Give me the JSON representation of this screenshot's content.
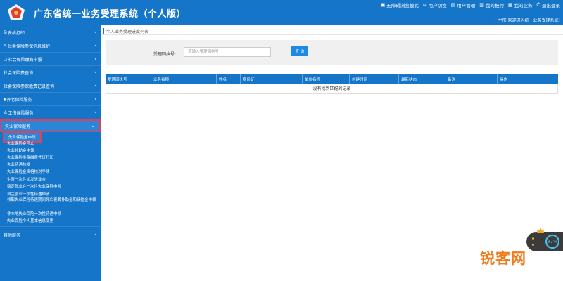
{
  "header": {
    "title": "广东省统一业务受理系统（个人版）",
    "links": [
      {
        "icon": "monitor-icon",
        "label": "无障碍浏览模式"
      },
      {
        "icon": "user-switch-icon",
        "label": "用户切换"
      },
      {
        "icon": "user-manage-icon",
        "label": "用户管理"
      },
      {
        "icon": "report-icon",
        "label": "我的报约"
      },
      {
        "icon": "briefcase-icon",
        "label": "我的业务"
      },
      {
        "icon": "power-icon",
        "label": "退出登录"
      }
    ],
    "welcome": "**彤,欢迎进入统一业务受理系统!"
  },
  "sidebar": {
    "items": [
      {
        "label": "表格打印"
      },
      {
        "label": "社会保险参保信息维护"
      },
      {
        "label": "社会保险缴费申报"
      },
      {
        "label": "社会保险费查询"
      },
      {
        "label": "社会保险参保缴费记录查询"
      },
      {
        "label": "养老保险服务"
      },
      {
        "label": "工伤保险服务"
      },
      {
        "label": "失业保险服务"
      },
      {
        "label": "其他服务"
      }
    ],
    "submenu": [
      "失业保险金申领",
      "失业保险金停止",
      "失业补助金申领",
      "失业保险参保缴费凭证打印",
      "失业待遇核发",
      "失业保险金资格核对手续",
      "生育一次性加发失业金",
      "稳定就业在一次性失业保险申领",
      "自主创业一次性待遇申请",
      "领取失业保险待遇期间死亡丧葬补助金和抚恤金申领",
      "非本地失业保险一次性待遇申领",
      "失业保险个人基本信息变更"
    ]
  },
  "main": {
    "breadcrumb": "个人业务受理进度列表",
    "search": {
      "label": "受理回执号:",
      "placeholder": "请输入受理回执号",
      "button": "查 询"
    },
    "table": {
      "headers": [
        "受理回执号",
        "业务名称",
        "姓名",
        "身份证",
        "单位名称",
        "创建时间",
        "最新状态",
        "备注",
        "操作"
      ],
      "empty_message": "没有找到匹配的记录"
    }
  },
  "widget": {
    "percent": "87%"
  },
  "watermark": "锐客网",
  "colors": {
    "primary": "#1575c9",
    "highlight_border": "#e0405a",
    "watermark": "#f07b1a"
  }
}
